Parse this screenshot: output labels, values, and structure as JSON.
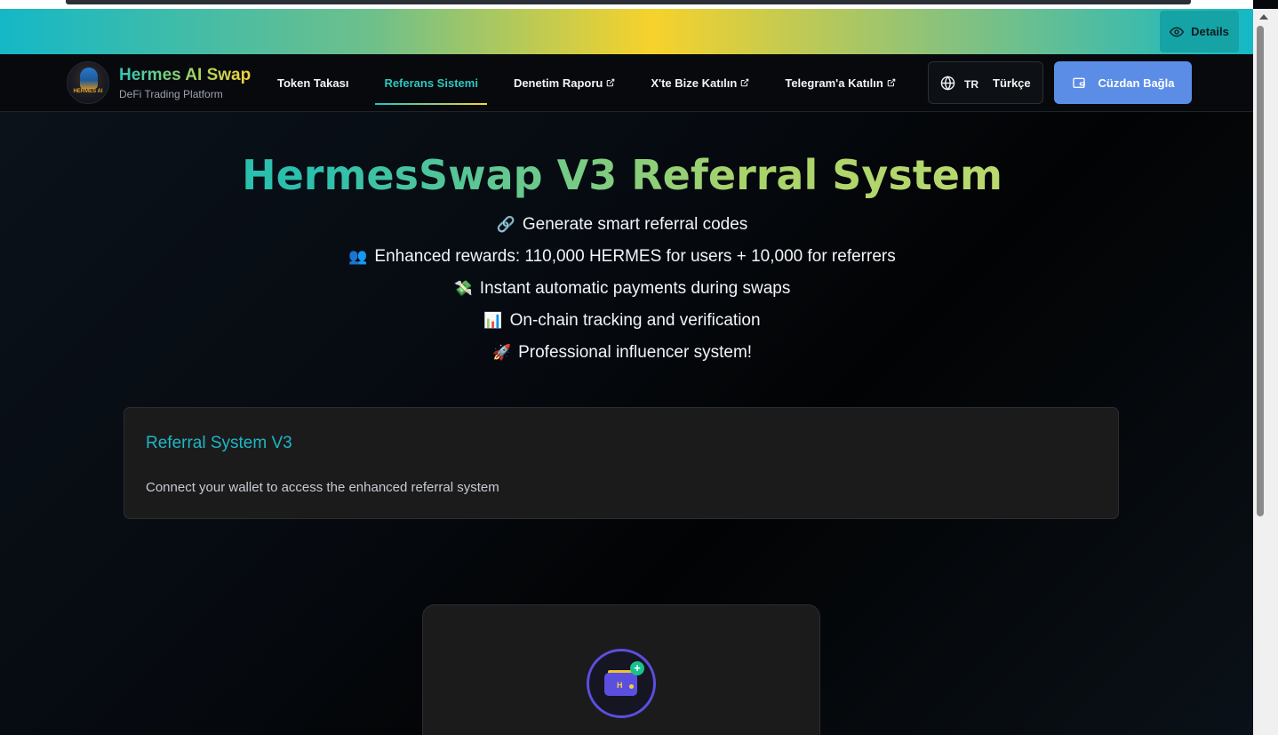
{
  "banner": {
    "details_label": "Details"
  },
  "brand": {
    "title": "Hermes AI Swap",
    "subtitle": "DeFi Trading Platform",
    "logo_text": "HERMES AI"
  },
  "nav": {
    "items": [
      {
        "label": "Token Takası",
        "active": false,
        "external": false
      },
      {
        "label": "Referans Sistemi",
        "active": true,
        "external": false
      },
      {
        "label": "Denetim Raporu",
        "active": false,
        "external": true
      },
      {
        "label": "X'te Bize Katılın",
        "active": false,
        "external": true
      },
      {
        "label": "Telegram'a Katılın",
        "active": false,
        "external": true
      }
    ],
    "language": {
      "code": "TR",
      "label": "Türkçe"
    },
    "wallet_button": "Cüzdan Bağla"
  },
  "hero": {
    "title": "HermesSwap V3 Referral System",
    "features": [
      {
        "emoji": "🔗",
        "text": "Generate smart referral codes"
      },
      {
        "emoji": "👥",
        "text": "Enhanced rewards: 110,000 HERMES for users + 10,000 for referrers"
      },
      {
        "emoji": "💸",
        "text": "Instant automatic payments during swaps"
      },
      {
        "emoji": "📊",
        "text": "On-chain tracking and verification"
      },
      {
        "emoji": "🚀",
        "text": "Professional influencer system!"
      }
    ]
  },
  "referral_card": {
    "title": "Referral System V3",
    "text": "Connect your wallet to access the enhanced referral system"
  },
  "connect_card": {
    "icon_letter": "H",
    "icon_plus": "+"
  },
  "colors": {
    "accent_teal": "#2ec6c0",
    "wallet_button": "#5b8de6",
    "wallet_icon": "#5b4fe0",
    "card_bg": "#1b1b1c"
  }
}
